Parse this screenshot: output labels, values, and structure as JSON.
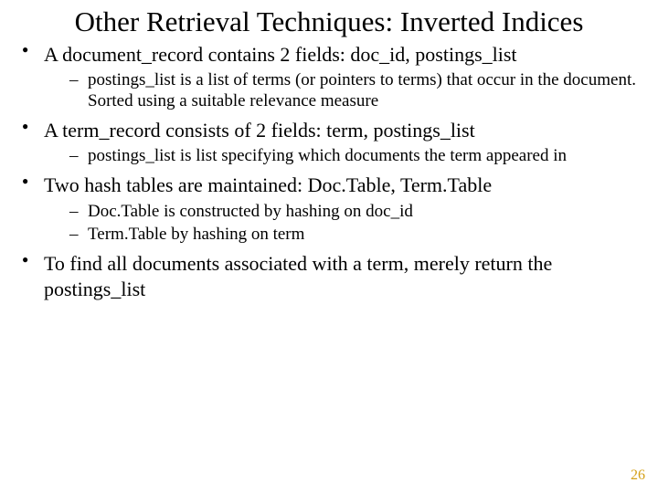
{
  "title": "Other Retrieval Techniques: Inverted Indices",
  "bullets": [
    {
      "text": "A document_record contains 2 fields: doc_id, postings_list",
      "sub": [
        "postings_list is a list of terms (or pointers to terms) that occur in the document. Sorted using a suitable relevance measure"
      ]
    },
    {
      "text": "A term_record consists of 2 fields: term, postings_list",
      "sub": [
        "postings_list is list specifying which documents the term appeared in"
      ]
    },
    {
      "text": "Two hash tables are maintained: Doc.Table, Term.Table",
      "sub": [
        "Doc.Table is constructed by hashing on doc_id",
        "Term.Table by hashing on term"
      ]
    },
    {
      "text": "To find all documents associated with a term, merely return the postings_list",
      "sub": []
    }
  ],
  "page_number": "26"
}
